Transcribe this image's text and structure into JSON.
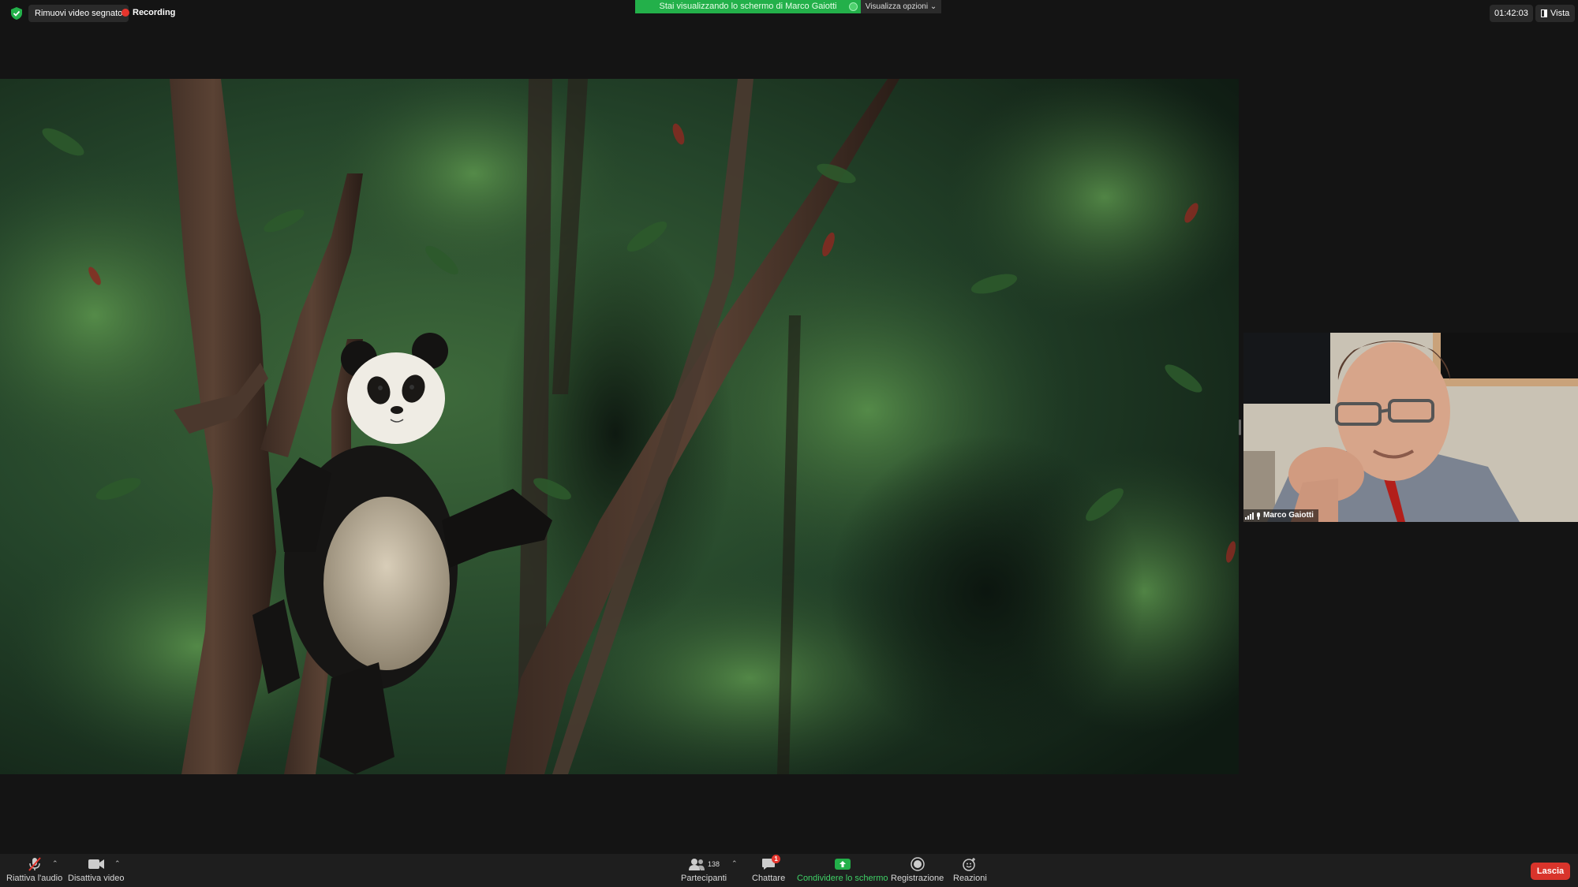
{
  "top_bar": {
    "hide_video_label": "Rimuovi video segnato",
    "recording_label": "Recording",
    "share_banner_text": "Stai visualizzando lo schermo di Marco Gaiotti",
    "view_options_label": "Visualizza opzioni",
    "clock": "01:42:03",
    "view_label": "Vista"
  },
  "participant": {
    "name": "Marco Gaiotti"
  },
  "toolbar": {
    "audio_label": "Riattiva l'audio",
    "video_label": "Disattiva video",
    "participants_label": "Partecipanti",
    "participants_count": "138",
    "chat_label": "Chattare",
    "chat_badge": "1",
    "share_label": "Condividere lo schermo",
    "record_label": "Registrazione",
    "reactions_label": "Reazioni",
    "leave_label": "Lascia"
  },
  "colors": {
    "accent_green": "#23b04a",
    "leave_red": "#d9342b",
    "recording_red": "#e5352d"
  }
}
